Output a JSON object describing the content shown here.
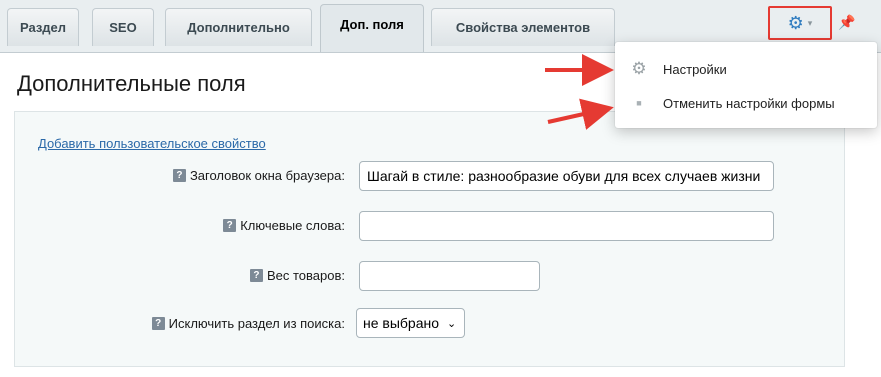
{
  "tabs": [
    {
      "label": "Раздел"
    },
    {
      "label": "SEO"
    },
    {
      "label": "Дополнительно"
    },
    {
      "label": "Доп. поля"
    },
    {
      "label": "Свойства элементов"
    }
  ],
  "toolbar": {
    "settings_icon": "gear-icon",
    "pin_icon": "pin-icon"
  },
  "panel": {
    "title": "Дополнительные поля",
    "add_link": "Добавить пользовательское свойство",
    "fields": [
      {
        "label": "Заголовок окна браузера:",
        "value": "Шагай в стиле: разнообразие обуви для всех случаев жизни"
      },
      {
        "label": "Ключевые слова:",
        "value": ""
      },
      {
        "label": "Вес товаров:",
        "value": ""
      },
      {
        "label": "Исключить раздел из поиска:",
        "value": "не выбрано"
      }
    ]
  },
  "menu": {
    "items": [
      {
        "label": "Настройки",
        "icon": "gear-icon"
      },
      {
        "label": "Отменить настройки формы",
        "icon": "bullet-icon"
      }
    ]
  },
  "colors": {
    "highlight": "#e53a32",
    "accent": "#2f7cc0",
    "link": "#2b69a8"
  }
}
